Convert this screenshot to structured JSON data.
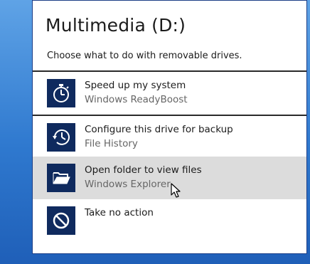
{
  "dialog": {
    "title": "Multimedia (D:)",
    "prompt": "Choose what to do with removable drives."
  },
  "options": [
    {
      "title": "Speed up my system",
      "subtitle": "Windows ReadyBoost",
      "icon": "stopwatch-icon"
    },
    {
      "title": "Configure this drive for backup",
      "subtitle": "File History",
      "icon": "history-clock-icon"
    },
    {
      "title": "Open folder to view files",
      "subtitle": "Windows Explorer",
      "icon": "open-folder-icon",
      "hovered": true
    },
    {
      "title": "Take no action",
      "subtitle": "",
      "icon": "no-action-icon"
    }
  ],
  "colors": {
    "tile": "#0f2a5e",
    "hover": "#dcdcdc",
    "desktop": "#2f79cf"
  }
}
